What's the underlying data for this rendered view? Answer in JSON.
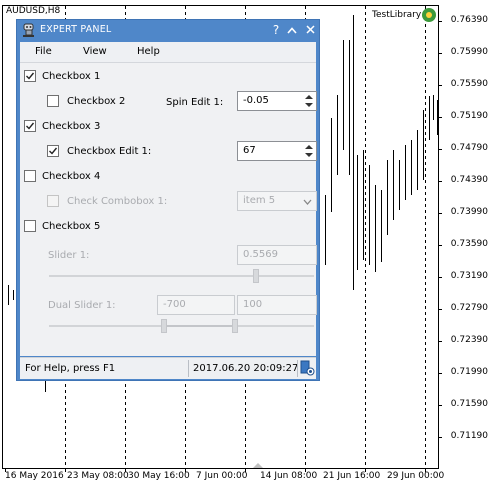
{
  "chart": {
    "symbol": "AUDUSD,H8",
    "indicator_label": "TestLibrary",
    "price_scale": [
      "0.76390",
      "0.75990",
      "0.75590",
      "0.75190",
      "0.74790",
      "0.74390",
      "0.73990",
      "0.73590",
      "0.73190",
      "0.72790",
      "0.72390",
      "0.71990",
      "0.71590",
      "0.71190"
    ],
    "time_scale": [
      "16 May 2016",
      "23 May 08:00",
      "30 May 16:00",
      "7 Jun 00:00",
      "14 Jun 08:00",
      "21 Jun 16:00",
      "29 Jun 00:00"
    ]
  },
  "panel": {
    "title": "EXPERT PANEL",
    "title_buttons": [
      "?",
      "^",
      "X"
    ],
    "menu": [
      "File",
      "View",
      "Help"
    ],
    "checkbox1": {
      "label": "Checkbox 1",
      "checked": true
    },
    "checkbox2": {
      "label": "Checkbox 2",
      "checked": false
    },
    "spin_edit1": {
      "label": "Spin Edit 1:",
      "value": "-0.05"
    },
    "checkbox3": {
      "label": "Checkbox 3",
      "checked": true
    },
    "checkbox_edit1": {
      "label": "Checkbox Edit 1:",
      "checked": true,
      "value": "67"
    },
    "checkbox4": {
      "label": "Checkbox 4",
      "checked": false
    },
    "check_combobox1": {
      "label": "Check Combobox 1:",
      "checked": false,
      "value": "item 5"
    },
    "checkbox5": {
      "label": "Checkbox 5",
      "checked": false
    },
    "slider1": {
      "label": "Slider 1:",
      "value": "0.5569",
      "position": 0.98
    },
    "dual_slider1": {
      "label": "Dual Slider 1:",
      "low": "-700",
      "high": "100"
    },
    "status": {
      "help": "For Help, press F1",
      "datetime": "2017.06.20 20:09:27"
    }
  }
}
